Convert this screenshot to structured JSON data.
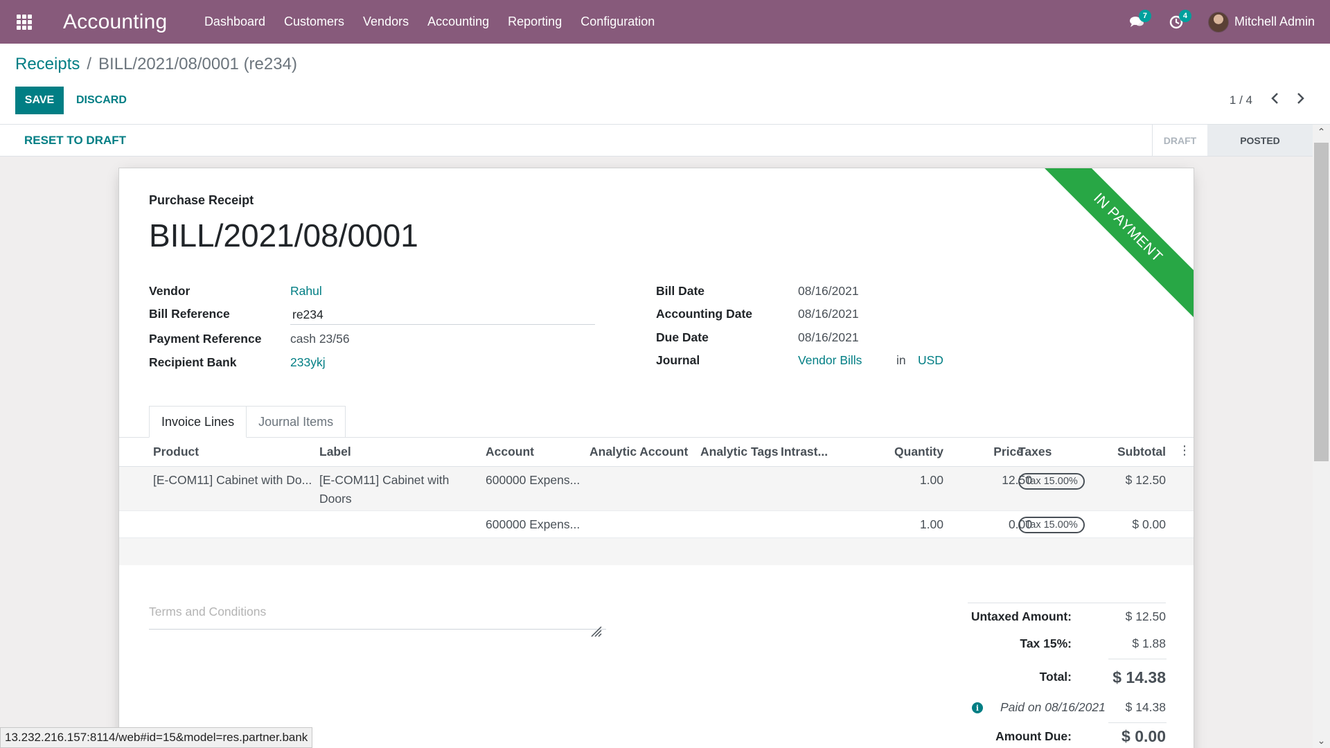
{
  "navbar": {
    "brand": "Accounting",
    "menu": [
      "Dashboard",
      "Customers",
      "Vendors",
      "Accounting",
      "Reporting",
      "Configuration"
    ],
    "messages_count": "7",
    "activities_count": "4",
    "user_name": "Mitchell Admin"
  },
  "breadcrumb": {
    "parent": "Receipts",
    "separator": "/",
    "current": "BILL/2021/08/0001 (re234)"
  },
  "actions": {
    "save": "SAVE",
    "discard": "DISCARD",
    "pager": "1 / 4"
  },
  "statusbar": {
    "reset": "RESET TO DRAFT",
    "states": [
      "DRAFT",
      "POSTED"
    ],
    "active_state": "POSTED"
  },
  "sheet": {
    "ribbon": "IN PAYMENT",
    "subtitle": "Purchase Receipt",
    "title": "BILL/2021/08/0001",
    "left_fields": {
      "vendor_label": "Vendor",
      "vendor_value": "Rahul",
      "bill_ref_label": "Bill Reference",
      "bill_ref_value": "re234",
      "payment_ref_label": "Payment Reference",
      "payment_ref_value": "cash 23/56",
      "recipient_bank_label": "Recipient Bank",
      "recipient_bank_value": "233ykj"
    },
    "right_fields": {
      "bill_date_label": "Bill Date",
      "bill_date_value": "08/16/2021",
      "accounting_date_label": "Accounting Date",
      "accounting_date_value": "08/16/2021",
      "due_date_label": "Due Date",
      "due_date_value": "08/16/2021",
      "journal_label": "Journal",
      "journal_value": "Vendor Bills",
      "journal_in": "in",
      "currency": "USD"
    },
    "tabs": [
      "Invoice Lines",
      "Journal Items"
    ],
    "table": {
      "headers": [
        "Product",
        "Label",
        "Account",
        "Analytic Account",
        "Analytic Tags",
        "Intrast...",
        "Quantity",
        "Price",
        "Taxes",
        "Subtotal"
      ],
      "rows": [
        {
          "product": "[E-COM11] Cabinet with Do...",
          "label_line1": "[E-COM11] Cabinet with",
          "label_line2": "Doors",
          "account": "600000 Expens...",
          "quantity": "1.00",
          "price": "12.50",
          "tax": "Tax 15.00%",
          "subtotal": "$ 12.50"
        },
        {
          "product": "",
          "label_line1": "",
          "label_line2": "",
          "account": "600000 Expens...",
          "quantity": "1.00",
          "price": "0.00",
          "tax": "Tax 15.00%",
          "subtotal": "$ 0.00"
        }
      ]
    },
    "terms_placeholder": "Terms and Conditions",
    "totals": {
      "untaxed_label": "Untaxed Amount:",
      "untaxed_value": "$ 12.50",
      "tax_label": "Tax 15%:",
      "tax_value": "$ 1.88",
      "total_label": "Total:",
      "total_value": "$ 14.38",
      "paid_label": "Paid on 08/16/2021",
      "paid_value": "$ 14.38",
      "due_label": "Amount Due:",
      "due_value": "$ 0.00"
    }
  },
  "status_url": "13.232.216.157:8114/web#id=15&model=res.partner.bank",
  "colors": {
    "navbar": "#875a7b",
    "primary": "#017e84",
    "ribbon": "#28a745"
  }
}
